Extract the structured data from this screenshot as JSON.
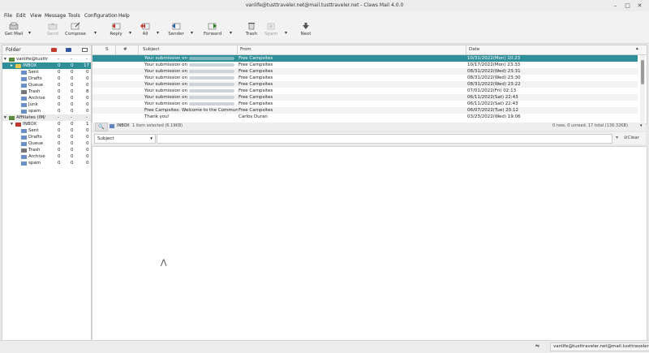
{
  "window": {
    "title": "vanlife@tusttraveler.net@mail.tusttraveler.net - Claws Mail 4.0.0"
  },
  "menu": [
    "File",
    "Edit",
    "View",
    "Message",
    "Tools",
    "Configuration",
    "Help"
  ],
  "toolbar": {
    "get_mail": "Get Mail",
    "send": "Send",
    "compose": "Compose",
    "reply": "Reply",
    "all": "All",
    "sender": "Sender",
    "forward": "Forward",
    "trash": "Trash",
    "spam": "Spam",
    "next": "Next"
  },
  "folders": {
    "header": "Folder",
    "account1": {
      "name": "vanlife@tusttr",
      "c1": "-",
      "c2": "-",
      "c3": "-"
    },
    "account1_items": [
      {
        "name": "INBOX",
        "c1": "0",
        "c2": "0",
        "c3": "17"
      },
      {
        "name": "Sent",
        "c1": "0",
        "c2": "0",
        "c3": "0"
      },
      {
        "name": "Drafts",
        "c1": "0",
        "c2": "0",
        "c3": "0"
      },
      {
        "name": "Queue",
        "c1": "0",
        "c2": "0",
        "c3": "0"
      },
      {
        "name": "Trash",
        "c1": "0",
        "c2": "0",
        "c3": "8"
      },
      {
        "name": "Archive",
        "c1": "0",
        "c2": "0",
        "c3": "0"
      },
      {
        "name": "Junk",
        "c1": "0",
        "c2": "0",
        "c3": "0"
      },
      {
        "name": "spam",
        "c1": "0",
        "c2": "0",
        "c3": "0"
      }
    ],
    "account2": {
      "name": "Affiliates (IM/",
      "c1": "-",
      "c2": "-",
      "c3": "-"
    },
    "account2_items": [
      {
        "name": "INBOX",
        "c1": "0",
        "c2": "0",
        "c3": "1"
      },
      {
        "name": "Sent",
        "c1": "0",
        "c2": "0",
        "c3": "0"
      },
      {
        "name": "Drafts",
        "c1": "0",
        "c2": "0",
        "c3": "0"
      },
      {
        "name": "Queue",
        "c1": "0",
        "c2": "0",
        "c3": "0"
      },
      {
        "name": "Trash",
        "c1": "0",
        "c2": "0",
        "c3": "0"
      },
      {
        "name": "Archive",
        "c1": "0",
        "c2": "0",
        "c3": "0"
      },
      {
        "name": "spam",
        "c1": "0",
        "c2": "0",
        "c3": "0"
      }
    ]
  },
  "messages": {
    "columns": {
      "s": "S",
      "attach": "#",
      "subject": "Subject",
      "from": "From",
      "date": "Date"
    },
    "rows": [
      {
        "subject": "Your submission on",
        "from": "Free Campsites",
        "date": "10/31/2022(Mon) 10:23"
      },
      {
        "subject": "Your submission on",
        "from": "Free Campsites",
        "date": "10/17/2022(Mon) 23:33"
      },
      {
        "subject": "Your submission on",
        "from": "Free Campsites",
        "date": "08/31/2022(Wed) 23:31"
      },
      {
        "subject": "Your submission on",
        "from": "Free Campsites",
        "date": "08/31/2022(Wed) 23:30"
      },
      {
        "subject": "Your submission on",
        "from": "Free Campsites",
        "date": "08/31/2022(Wed) 23:22"
      },
      {
        "subject": "Your submission on",
        "from": "Free Campsites",
        "date": "07/01/2022(Fri) 02:13"
      },
      {
        "subject": "Your submission on",
        "from": "Free Campsites",
        "date": "06/11/2022(Sat) 22:43"
      },
      {
        "subject": "Your submission on",
        "from": "Free Campsites",
        "date": "06/11/2022(Sat) 22:43"
      },
      {
        "subject": "Free Campsites: Welcome to the Commun",
        "from": "Free Campsites",
        "date": "06/07/2022(Tue) 20:12"
      },
      {
        "subject": "Thank you!",
        "from": "Carlos Duran",
        "date": "03/23/2022(Wed) 19:06"
      }
    ]
  },
  "midstatus": {
    "folder": "INBOX",
    "selected": "1 item selected (6.19KB)",
    "summary": "0 new, 0 unread, 17 total (136.32KB)"
  },
  "search": {
    "field": "Subject",
    "clear": "Clear"
  },
  "statusbar": {
    "account": "vanlife@tusttraveler.net@mail.tusttraveler.net"
  }
}
